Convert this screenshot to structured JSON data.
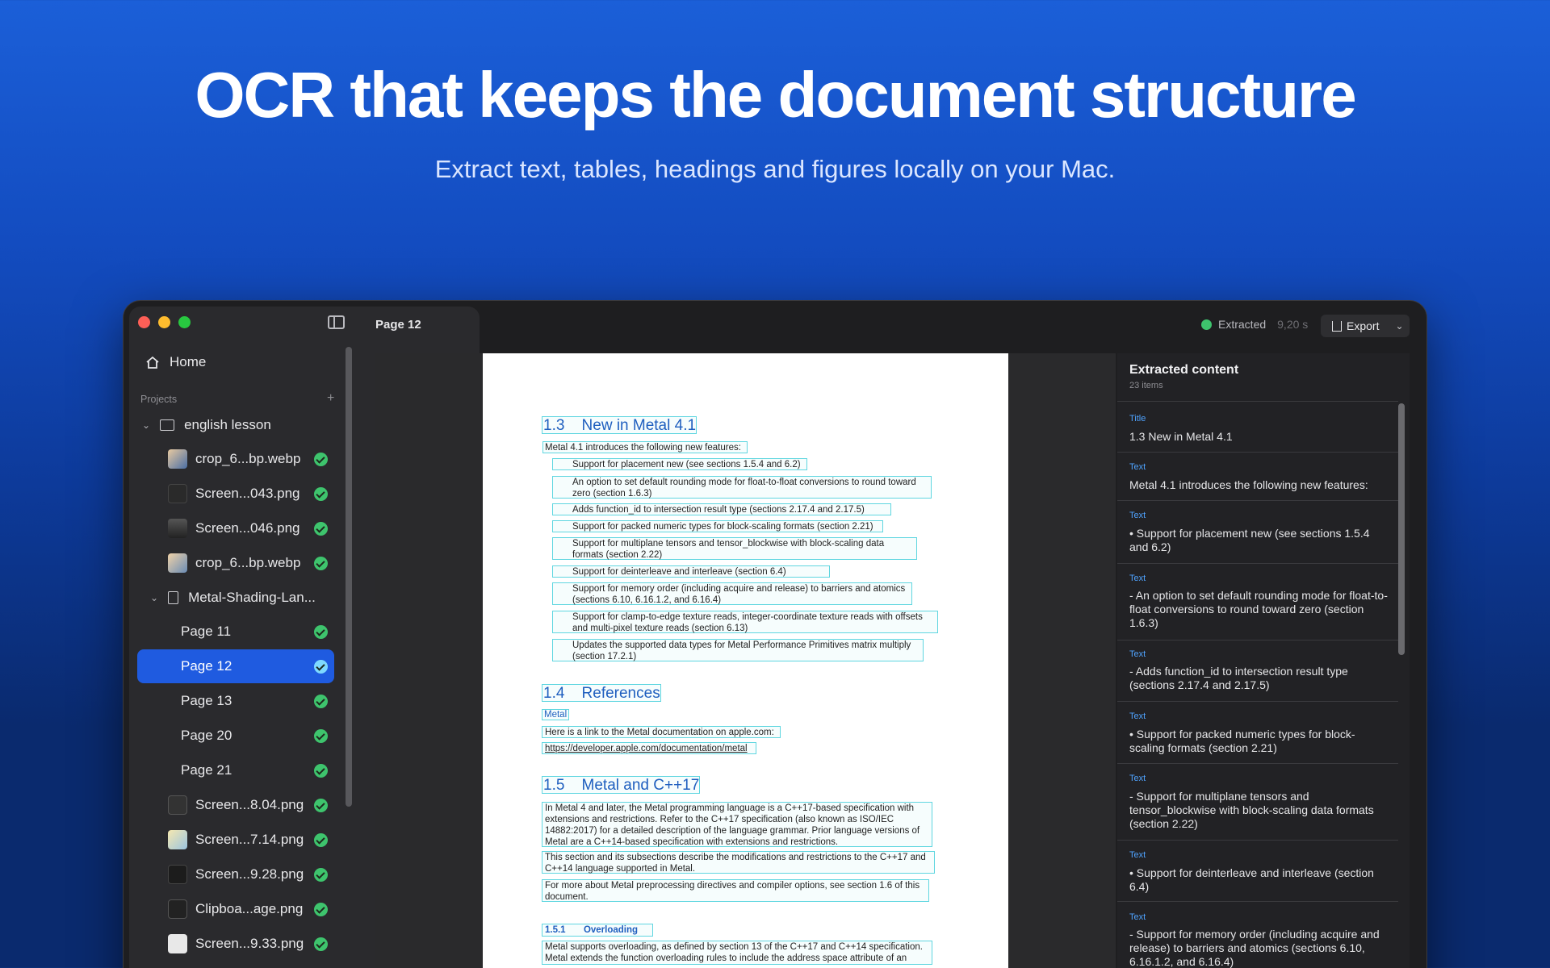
{
  "hero": {
    "title": "OCR that keeps the document structure",
    "subtitle": "Extract text, tables, headings and figures locally on your Mac."
  },
  "colors": {
    "accent": "#1f5be0",
    "success": "#3ec46d",
    "highlight": "#5fd6e0",
    "link": "#4fa3ff"
  },
  "sidebar": {
    "home_label": "Home",
    "projects_label": "Projects",
    "add_icon": "plus-icon",
    "project": {
      "name": "english lesson",
      "items": [
        {
          "label": "crop_6...bp.webp"
        },
        {
          "label": "Screen...043.png"
        },
        {
          "label": "Screen...046.png"
        },
        {
          "label": "crop_6...bp.webp"
        }
      ],
      "doc": {
        "name": "Metal-Shading-Lan...",
        "pages": [
          {
            "label": "Page 11"
          },
          {
            "label": "Page 12"
          },
          {
            "label": "Page 13"
          },
          {
            "label": "Page 20"
          },
          {
            "label": "Page 21"
          }
        ]
      },
      "more_items": [
        {
          "label": "Screen...8.04.png"
        },
        {
          "label": "Screen...7.14.png"
        },
        {
          "label": "Screen...9.28.png"
        },
        {
          "label": "Clipboa...age.png"
        },
        {
          "label": "Screen...9.33.png"
        }
      ]
    }
  },
  "main": {
    "title": "Page 12",
    "status": "Extracted",
    "duration": "9,20 s",
    "export_label": "Export"
  },
  "document": {
    "h13": "1.3    New in Metal 4.1",
    "intro": "Metal 4.1 introduces the following new features:",
    "bullets": [
      "Support for placement new (see sections 1.5.4 and 6.2)",
      "An option to set default rounding mode for float-to-float conversions to round toward zero (section 1.6.3)",
      "Adds function_id to intersection result type (sections 2.17.4 and 2.17.5)",
      "Support for packed numeric types for block-scaling formats (section 2.21)",
      "Support for multiplane tensors and tensor_blockwise with block-scaling data formats (section 2.22)",
      "Support for deinterleave and interleave (section 6.4)",
      "Support for memory order (including acquire and release) to barriers and atomics (sections 6.10, 6.16.1.2, and 6.16.4)",
      "Support for clamp-to-edge texture reads, integer-coordinate texture reads with offsets and multi-pixel texture reads (section 6.13)",
      "Updates the supported data types for Metal Performance Primitives matrix multiply (section 17.2.1)"
    ],
    "h14": "1.4    References",
    "metal": "Metal",
    "ref_text": "Here is a link to the Metal documentation on apple.com:",
    "ref_url": "https://developer.apple.com/documentation/metal",
    "h15": "1.5    Metal and C++17",
    "p1": "In Metal 4 and later, the Metal programming language is a C++17-based specification with extensions and restrictions. Refer to the C++17 specification (also known as ISO/IEC 14882:2017) for a detailed description of the language grammar.  Prior language versions of Metal are a C++14-based specification with extensions and restrictions.",
    "p2": "This section and its subsections describe the modifications and restrictions to the C++17 and C++14 language supported in Metal.",
    "p3": "For more about Metal preprocessing directives and compiler options, see section 1.6 of this document.",
    "h151": "1.5.1       Overloading",
    "p4": "Metal supports overloading, as defined by section 13 of the C++17 and C++14 specification. Metal extends the function overloading rules to include the address space attribute of an"
  },
  "extracted": {
    "title": "Extracted content",
    "count": "23 items",
    "items": [
      {
        "type": "Title",
        "text": "1.3 New in Metal 4.1"
      },
      {
        "type": "Text",
        "text": "Metal 4.1 introduces the following new features:"
      },
      {
        "type": "Text",
        "text": "• Support for placement new (see sections 1.5.4 and 6.2)"
      },
      {
        "type": "Text",
        "text": "- An option to set default rounding mode for float-to-float conversions to round toward zero (section 1.6.3)"
      },
      {
        "type": "Text",
        "text": "- Adds function_id to intersection result type (sections 2.17.4 and 2.17.5)"
      },
      {
        "type": "Text",
        "text": "• Support for packed numeric types for block-scaling formats (section 2.21)"
      },
      {
        "type": "Text",
        "text": "- Support for multiplane tensors and tensor_blockwise with block-scaling data formats (section 2.22)"
      },
      {
        "type": "Text",
        "text": "• Support for deinterleave and interleave (section 6.4)"
      },
      {
        "type": "Text",
        "text": "- Support for memory order (including acquire and release) to barriers and atomics (sections 6.10, 6.16.1.2, and 6.16.4)"
      }
    ]
  }
}
